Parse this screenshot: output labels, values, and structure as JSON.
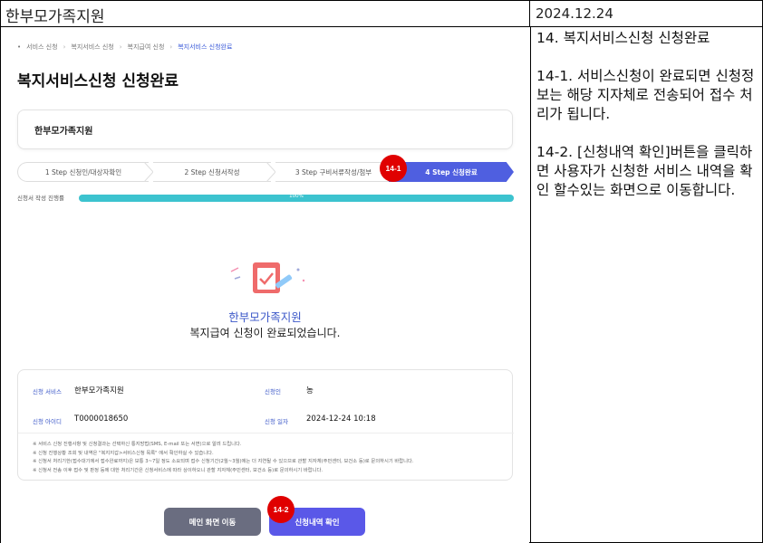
{
  "header": {
    "title": "한부모가족지원",
    "date": "2024.12.24"
  },
  "notes": {
    "heading": "14. 복지서비스신청 신청완료",
    "item1": "14-1. 서비스신청이 완료되면 신청정보는 해당 지자체로 전송되어 접수 처리가 됩니다.",
    "item2": "14-2. [신청내역 확인]버튼을 클릭하면 사용자가 신청한 서비스 내역을 확인 할수있는 화면으로 이동합니다."
  },
  "breadcrumb": {
    "items": [
      "서비스 신청",
      "복지서비스 신청",
      "복지급여 신청",
      "복지서비스 신청완료"
    ]
  },
  "page": {
    "title": "복지서비스신청 신청완료",
    "service_name": "한부모가족지원"
  },
  "steps": [
    {
      "label": "1 Step 신청인/대상자확인"
    },
    {
      "label": "2 Step 신청서작성"
    },
    {
      "label": "3 Step 구비서류작성/첨부"
    },
    {
      "label": "4 Step 신청완료"
    }
  ],
  "progress": {
    "label": "신청서 작성 진행률",
    "value_text": "100%",
    "value": 1.0
  },
  "completion": {
    "service": "한부모가족지원",
    "message": "복지급여 신청이 완료되었습니다."
  },
  "info": {
    "service_label": "신청 서비스",
    "service_value": "한부모가족지원",
    "applicant_label": "신청인",
    "applicant_value": "농",
    "id_label": "신청 아이디",
    "id_value": "T0000018650",
    "date_label": "신청 일자",
    "date_value": "2024-12-24 10:18",
    "notices": [
      "※ 서비스 신청 진행사항 및 신청결과는 선택하신 통지방법(SMS, E-mail 또는 서면)으로 알려 드립니다.",
      "※ 신청 진행상황 조회 및 내역은 \"복지지갑>서비스신청 목록\" 에서 확인하실 수 있습니다.",
      "※ 신청서 처리기한(접수대기에서 접수완료까지)은 보통 3~7일 정도 소요되며 접수 신청기간(2월~3월)에는 더 지연될 수 있으므로 관할 지자체(주민센터, 보건소 등)로 문의하시기 바랍니다.",
      "※ 신청서 전송 이후 접수 및 판정 등에 대한 처리기간은 신청서비스에 따라 상이하오니 관할 지자체(주민센터, 보건소 등)로 문의하시기 바랍니다."
    ]
  },
  "buttons": {
    "main": "메인 화면 이동",
    "check": "신청내역 확인"
  },
  "badges": {
    "b1": "14-1",
    "b2": "14-2"
  },
  "colors": {
    "accent": "#4f5fe0",
    "progress": "#3cc3cf",
    "badge": "#e00000"
  }
}
